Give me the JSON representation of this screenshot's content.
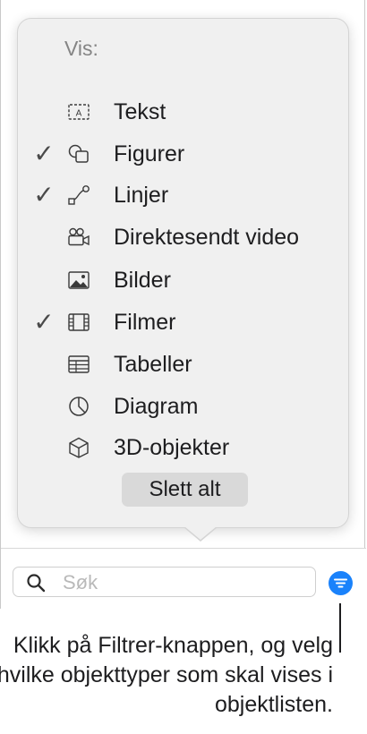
{
  "popover": {
    "heading": "Vis:",
    "items": [
      {
        "label": "Tekst",
        "icon": "text-box-icon",
        "checked": false,
        "check_mark": ""
      },
      {
        "label": "Figurer",
        "icon": "shapes-icon",
        "checked": true,
        "check_mark": "✓"
      },
      {
        "label": "Linjer",
        "icon": "line-icon",
        "checked": true,
        "check_mark": "✓"
      },
      {
        "label": "Direktesendt video",
        "icon": "live-video-icon",
        "checked": false,
        "check_mark": ""
      },
      {
        "label": "Bilder",
        "icon": "image-icon",
        "checked": false,
        "check_mark": ""
      },
      {
        "label": "Filmer",
        "icon": "film-icon",
        "checked": true,
        "check_mark": "✓"
      },
      {
        "label": "Tabeller",
        "icon": "table-icon",
        "checked": false,
        "check_mark": ""
      },
      {
        "label": "Diagram",
        "icon": "pie-chart-icon",
        "checked": false,
        "check_mark": ""
      },
      {
        "label": "3D-objekter",
        "icon": "cube-icon",
        "checked": false,
        "check_mark": ""
      }
    ],
    "clear_button": "Slett alt"
  },
  "search": {
    "placeholder": "Søk"
  },
  "filter_button": {
    "icon": "filter-icon",
    "color": "#1a82fb"
  },
  "caption": "Klikk på Filtrer-knappen, og velg hvilke objekttyper som skal vises i objektlisten."
}
